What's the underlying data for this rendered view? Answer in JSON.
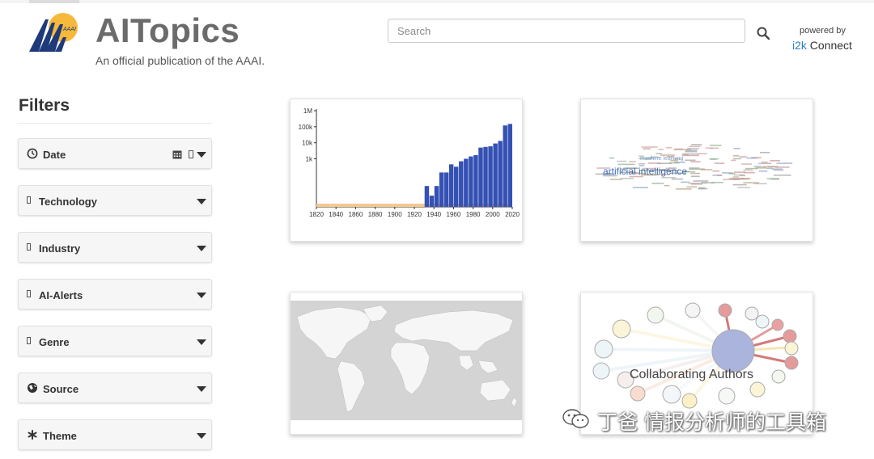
{
  "brand": {
    "title": "AITopics",
    "subtitle": "An official publication of the AAAI.",
    "logo_text": "AAAI"
  },
  "search": {
    "placeholder": "Search",
    "icon": "search-icon"
  },
  "powered": {
    "label": "powered by",
    "brand_prefix": "i2k",
    "brand_suffix": " Connect"
  },
  "filters": {
    "title": "Filters",
    "items": [
      {
        "label": "Date",
        "icon": "clock-icon"
      },
      {
        "label": "Technology",
        "icon": "box-icon"
      },
      {
        "label": "Industry",
        "icon": "box-icon"
      },
      {
        "label": "AI-Alerts",
        "icon": "box-icon"
      },
      {
        "label": "Genre",
        "icon": "box-icon"
      },
      {
        "label": "Source",
        "icon": "globe-icon"
      },
      {
        "label": "Theme",
        "icon": "asterisk-icon"
      }
    ]
  },
  "cards": {
    "timeline": {
      "chart_data": {
        "type": "bar",
        "scale": "log",
        "yticks": [
          "1M",
          "100k",
          "10k",
          "1k"
        ],
        "xticks": [
          "1820",
          "1840",
          "1860",
          "1880",
          "1900",
          "1920",
          "1940",
          "1960",
          "1980",
          "2000",
          "2020"
        ],
        "x": [
          1935,
          1940,
          1945,
          1950,
          1955,
          1960,
          1965,
          1970,
          1975,
          1980,
          1985,
          1990,
          1995,
          2000,
          2005,
          2010,
          2015,
          2020
        ],
        "values": [
          20,
          5,
          20,
          140,
          140,
          450,
          320,
          700,
          1000,
          1400,
          1700,
          5000,
          5500,
          6000,
          9000,
          13000,
          120000,
          150000
        ],
        "colors": {
          "bar": "#3451b3",
          "band": "#f4c98d"
        }
      }
    },
    "wordcloud": {
      "main_word": "artificial intelligence",
      "secondary_word": "machine learning"
    },
    "map": {},
    "network": {
      "label": "Collaborating Authors"
    }
  },
  "watermark": {
    "text": "丁爸 情报分析师的工具箱"
  },
  "colors": {
    "bar": "#3451b3",
    "orange_band": "#f4c98d",
    "network_center": "#aab4dc"
  }
}
